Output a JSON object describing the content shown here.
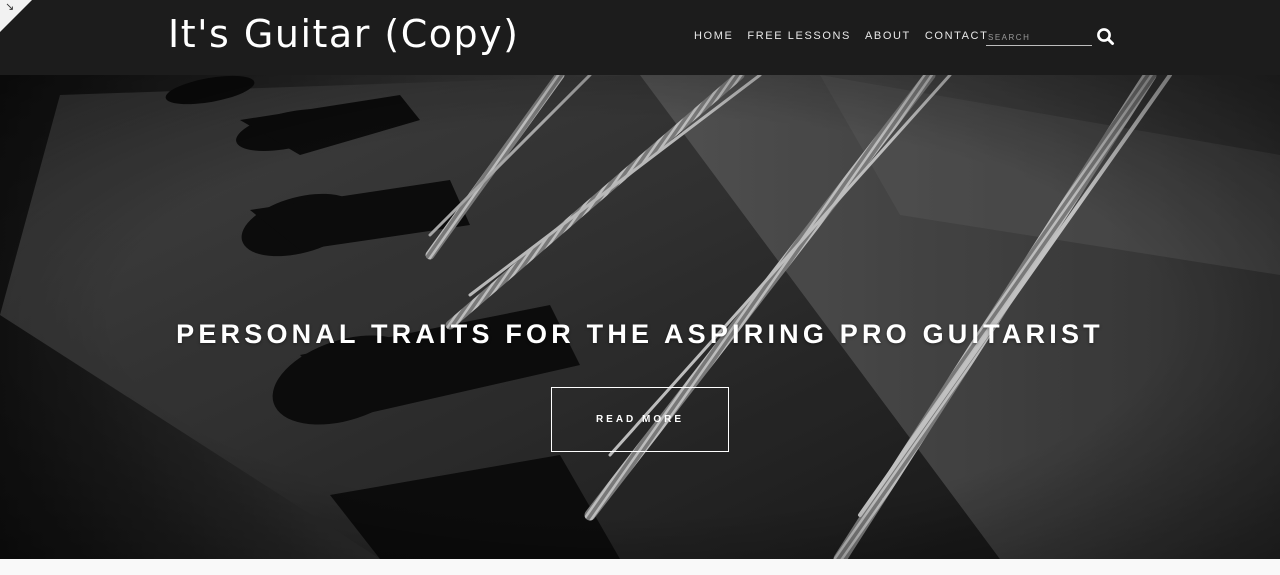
{
  "site": {
    "title": "It's Guitar (Copy)"
  },
  "nav": {
    "items": [
      {
        "label": "HOME"
      },
      {
        "label": "FREE LESSONS"
      },
      {
        "label": "ABOUT"
      },
      {
        "label": "CONTACT"
      }
    ]
  },
  "search": {
    "placeholder": "SEARCH",
    "icon": "search-icon"
  },
  "hero": {
    "title": "PERSONAL TRAITS FOR THE ASPIRING PRO GUITARIST",
    "button_label": "READ MORE",
    "image": "black-and-white close-up of guitar strings"
  },
  "colors": {
    "header_bg": "#1c1c1c",
    "text": "#ffffff",
    "page_bg": "#f7f7f7"
  }
}
